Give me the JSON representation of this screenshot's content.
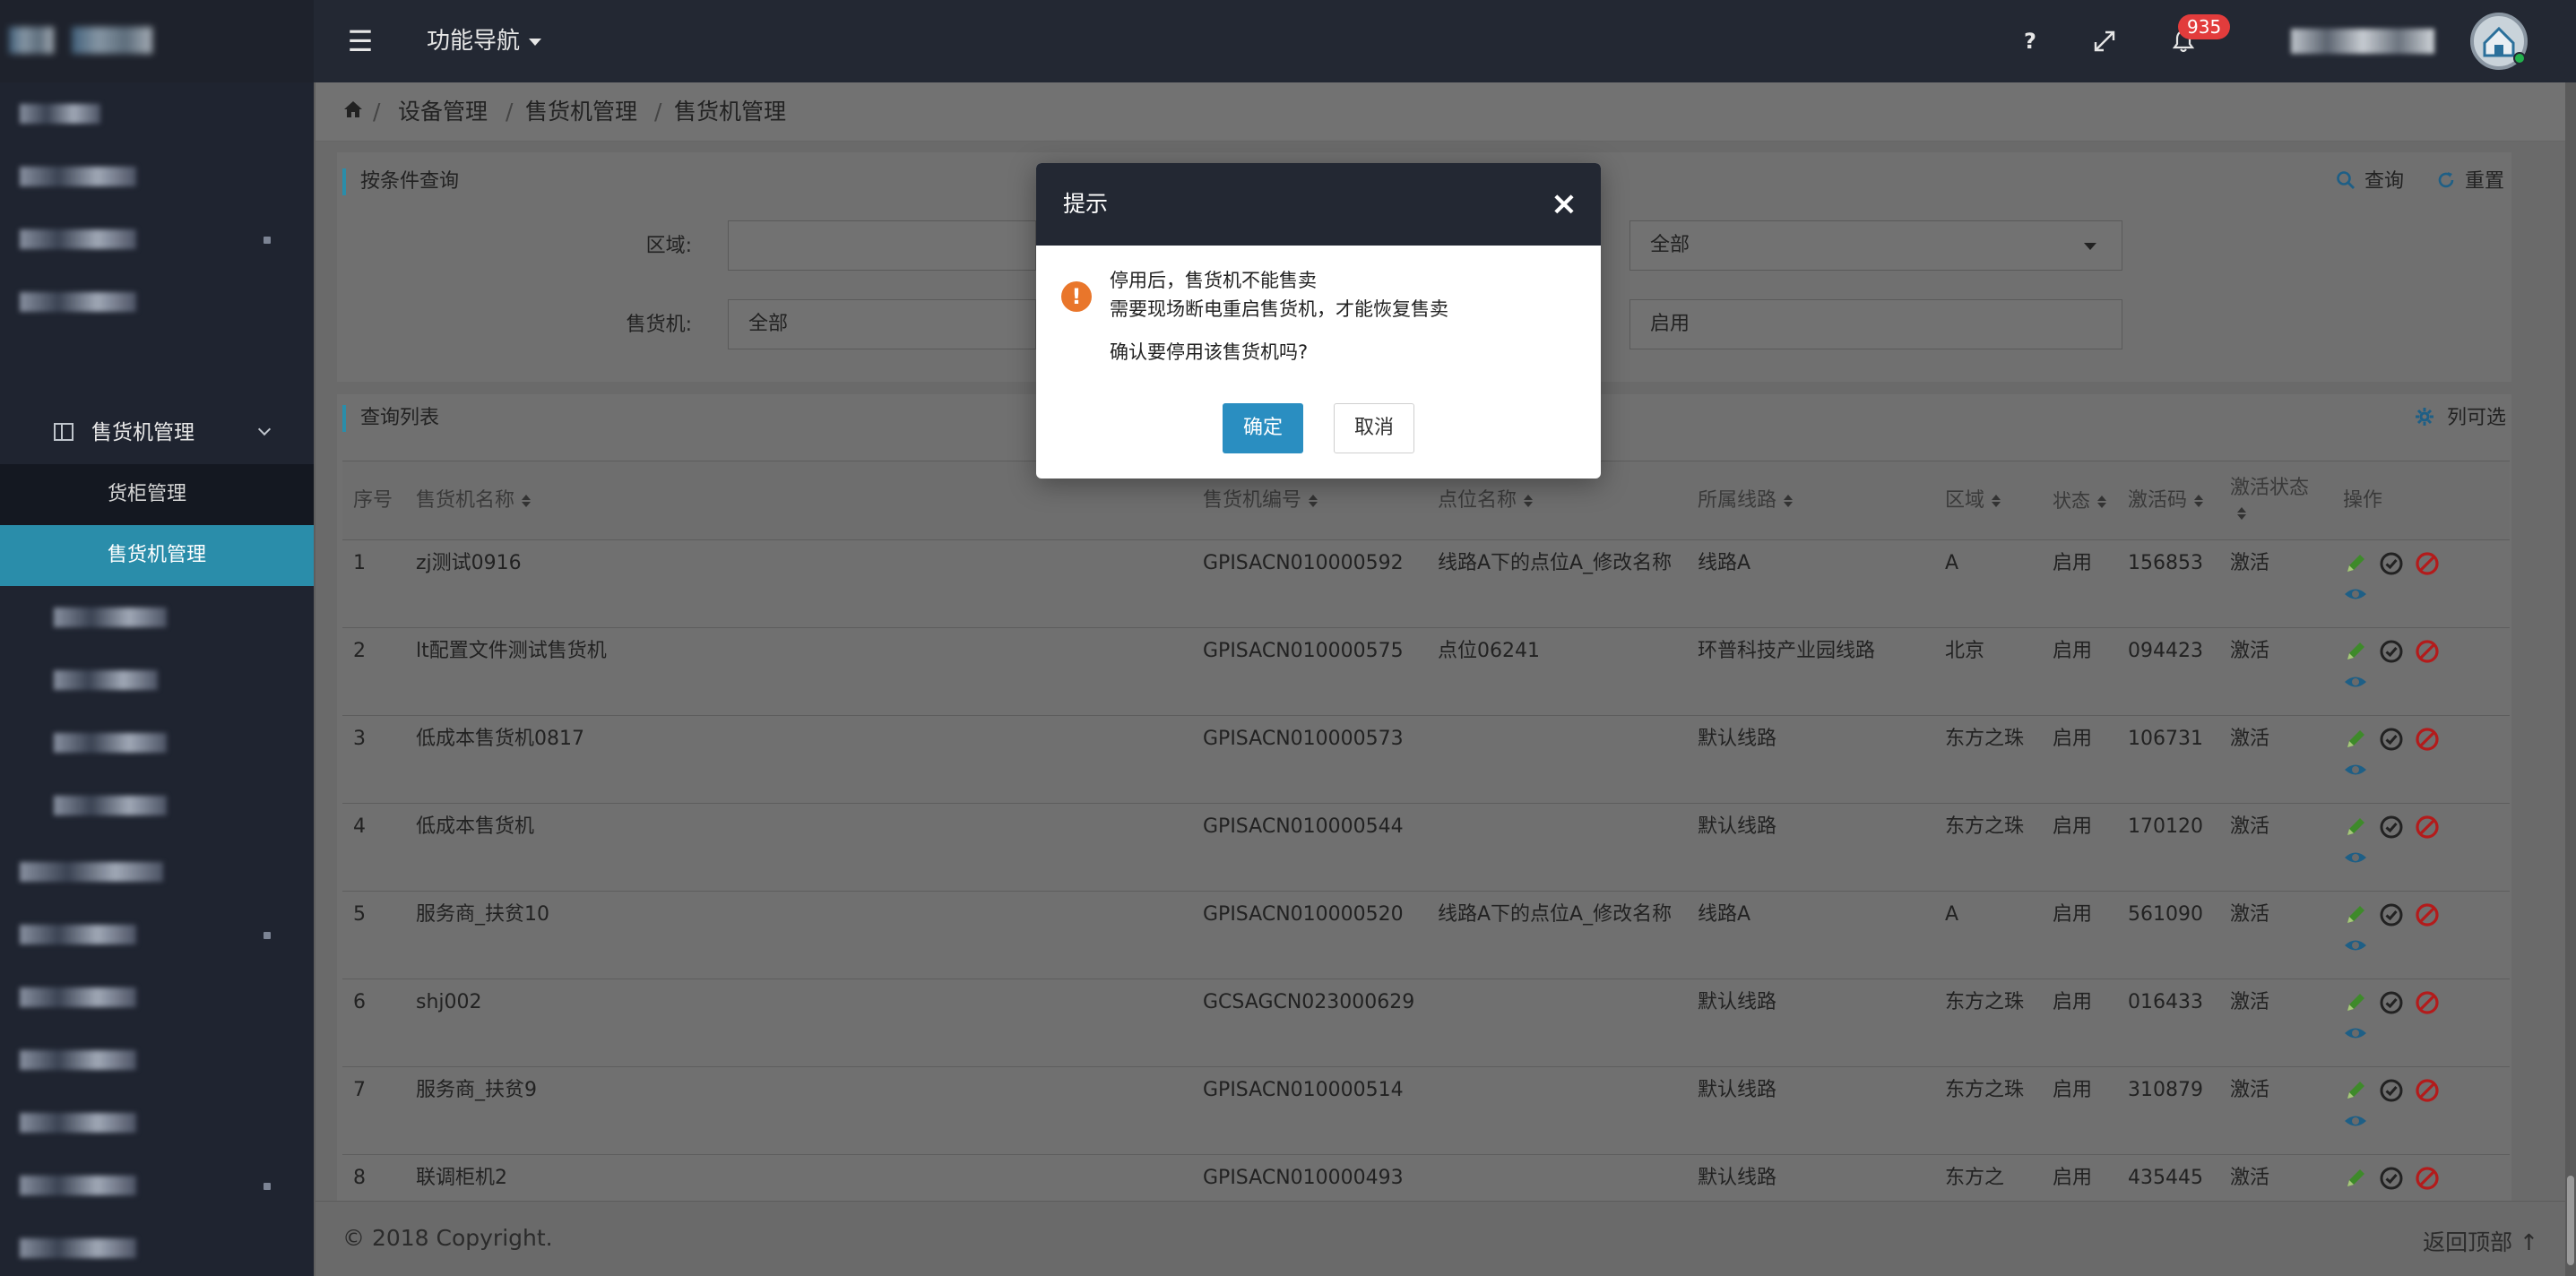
{
  "header": {
    "func_nav": "功能导航",
    "help": "?",
    "notifications_count": "935"
  },
  "sidebar": {
    "open_group": "售货机管理",
    "leaves": [
      "货柜管理",
      "售货机管理"
    ]
  },
  "breadcrumb": [
    "设备管理",
    "售货机管理",
    "售货机管理"
  ],
  "filter": {
    "title": "按条件查询",
    "area_label": "区域:",
    "machine_label": "售货机:",
    "machine_value": "全部",
    "right_select_value": "全部",
    "status_value": "启用",
    "query_btn": "查询",
    "reset_btn": "重置"
  },
  "list": {
    "title": "查询列表",
    "column_toggle": "列可选",
    "headers": {
      "index": "序号",
      "name": "售货机名称",
      "code": "售货机编号",
      "point": "点位名称",
      "line": "所属线路",
      "area": "区域",
      "status": "状态",
      "act_code": "激活码",
      "act_status": "激活状态",
      "ops": "操作"
    },
    "rows": [
      {
        "index": "1",
        "name": "zj测试0916",
        "code": "GPISACN010000592",
        "point": "线路A下的点位A_修改名称",
        "line": "线路A",
        "area": "A",
        "status": "启用",
        "act_code": "156853",
        "act_status": "激活"
      },
      {
        "index": "2",
        "name": "lt配置文件测试售货机",
        "code": "GPISACN010000575",
        "point": "点位06241",
        "line": "环普科技产业园线路",
        "area": "北京",
        "status": "启用",
        "act_code": "094423",
        "act_status": "激活"
      },
      {
        "index": "3",
        "name": "低成本售货机0817",
        "code": "GPISACN010000573",
        "point": "",
        "line": "默认线路",
        "area": "东方之珠",
        "status": "启用",
        "act_code": "106731",
        "act_status": "激活"
      },
      {
        "index": "4",
        "name": "低成本售货机",
        "code": "GPISACN010000544",
        "point": "",
        "line": "默认线路",
        "area": "东方之珠",
        "status": "启用",
        "act_code": "170120",
        "act_status": "激活"
      },
      {
        "index": "5",
        "name": "服务商_扶贫10",
        "code": "GPISACN010000520",
        "point": "线路A下的点位A_修改名称",
        "line": "线路A",
        "area": "A",
        "status": "启用",
        "act_code": "561090",
        "act_status": "激活"
      },
      {
        "index": "6",
        "name": "shj002",
        "code": "GCSAGCN023000629",
        "point": "",
        "line": "默认线路",
        "area": "东方之珠",
        "status": "启用",
        "act_code": "016433",
        "act_status": "激活"
      },
      {
        "index": "7",
        "name": "服务商_扶贫9",
        "code": "GPISACN010000514",
        "point": "",
        "line": "默认线路",
        "area": "东方之珠",
        "status": "启用",
        "act_code": "310879",
        "act_status": "激活"
      },
      {
        "index": "8",
        "name": "联调柜机2",
        "code": "GPISACN010000493",
        "point": "",
        "line": "默认线路",
        "area": "东方之",
        "status": "启用",
        "act_code": "435445",
        "act_status": "激活"
      }
    ]
  },
  "footer": {
    "copyright": "© 2018 Copyright.",
    "back_to_top": "返回顶部"
  },
  "modal": {
    "title": "提示",
    "line1": "停用后，售货机不能售卖",
    "line2": "需要现场断电重启售货机，才能恢复售卖",
    "line3": "确认要停用该售货机吗?",
    "ok": "确定",
    "cancel": "取消"
  },
  "colors": {
    "topbar": "#232833",
    "sidebar": "#1f2430",
    "active_item": "#2a8daa",
    "ok_button": "#2a8ec1",
    "warn": "#e9762b"
  }
}
